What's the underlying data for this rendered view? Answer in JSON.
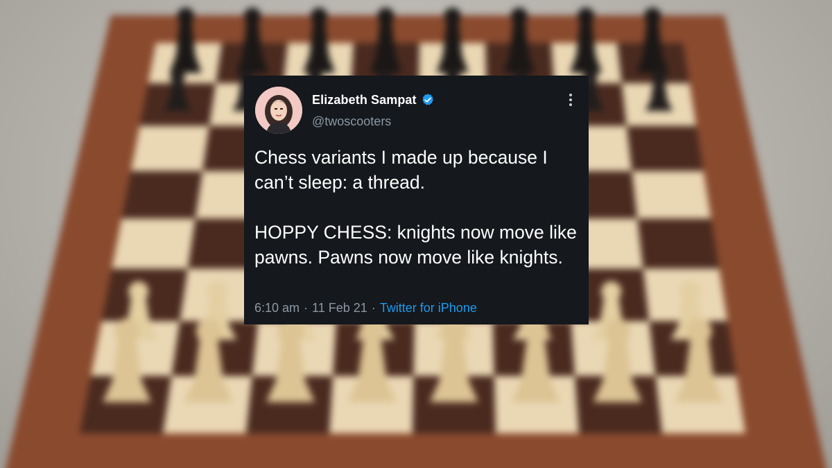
{
  "tweet": {
    "display_name": "Elizabeth Sampat",
    "handle": "@twoscooters",
    "verified": true,
    "paragraphs": [
      "Chess variants I made up because I can’t sleep: a thread.",
      "HOPPY CHESS: knights now move like pawns. Pawns now move like knights."
    ],
    "time": "6:10 am",
    "date": "11 Feb 21",
    "separator": "·",
    "source": "Twitter for iPhone"
  },
  "icons": {
    "verified": "verified-badge-icon",
    "more": "more-options-icon"
  },
  "colors": {
    "card_background": "#15181c",
    "text_primary": "#ffffff",
    "text_secondary": "#8b98a5",
    "link": "#1d9bf0",
    "verified_badge": "#1d9bf0"
  }
}
